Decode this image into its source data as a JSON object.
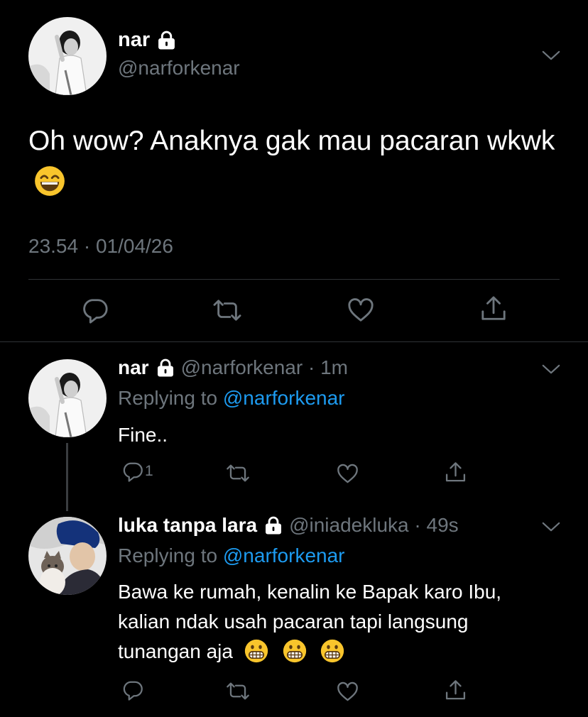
{
  "main_tweet": {
    "name": "nar",
    "handle": "@narforkenar",
    "text": "Oh wow? Anaknya gak mau pacaran wkwk",
    "emoji": "grinning-face-with-smiling-eyes",
    "timestamp": "23.54 · 01/04/26",
    "icons": {
      "lock": "lock-icon",
      "more": "chevron-down-icon",
      "reply": "reply-icon",
      "retweet": "retweet-icon",
      "like": "heart-icon",
      "share": "share-icon"
    }
  },
  "replies": [
    {
      "name": "nar",
      "handle": "@narforkenar",
      "time": "1m",
      "replying_label": "Replying to ",
      "replying_to": "@narforkenar",
      "text": "Fine..",
      "reply_count": "1"
    },
    {
      "name": "luka tanpa lara",
      "handle": "@iniadekluka",
      "time": "49s",
      "replying_label": "Replying to ",
      "replying_to": "@narforkenar",
      "text_lines": [
        "Bawa ke rumah, kenalin ke Bapak karo Ibu,",
        "kalian ndak usah pacaran tapi langsung",
        "tunangan aja"
      ],
      "emoji": [
        "grimacing-face",
        "grimacing-face",
        "grimacing-face"
      ]
    }
  ],
  "colors": {
    "background": "#000000",
    "text": "#ffffff",
    "muted": "#6e767d",
    "link": "#1d9bf0",
    "divider": "#2f3336",
    "emoji_yellow": "#f9c52c"
  }
}
